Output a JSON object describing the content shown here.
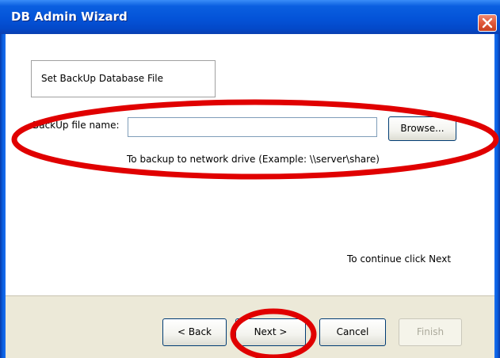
{
  "window": {
    "title": "DB Admin Wizard",
    "close_icon": "close-icon"
  },
  "step": {
    "label": "Set BackUp Database File"
  },
  "backup_file": {
    "label": "BackUp file name:",
    "value": "",
    "placeholder": "",
    "browse_label": "Browse...",
    "hint": "To backup to network drive (Example: \\\\server\\share)"
  },
  "continue_hint": "To continue click Next",
  "buttons": {
    "back_label": "< Back",
    "next_label": "Next >",
    "cancel_label": "Cancel",
    "finish_label": "Finish"
  },
  "colors": {
    "titlebar": "#0453d8",
    "annotation_red": "#e00000",
    "footer": "#ece9d8"
  }
}
